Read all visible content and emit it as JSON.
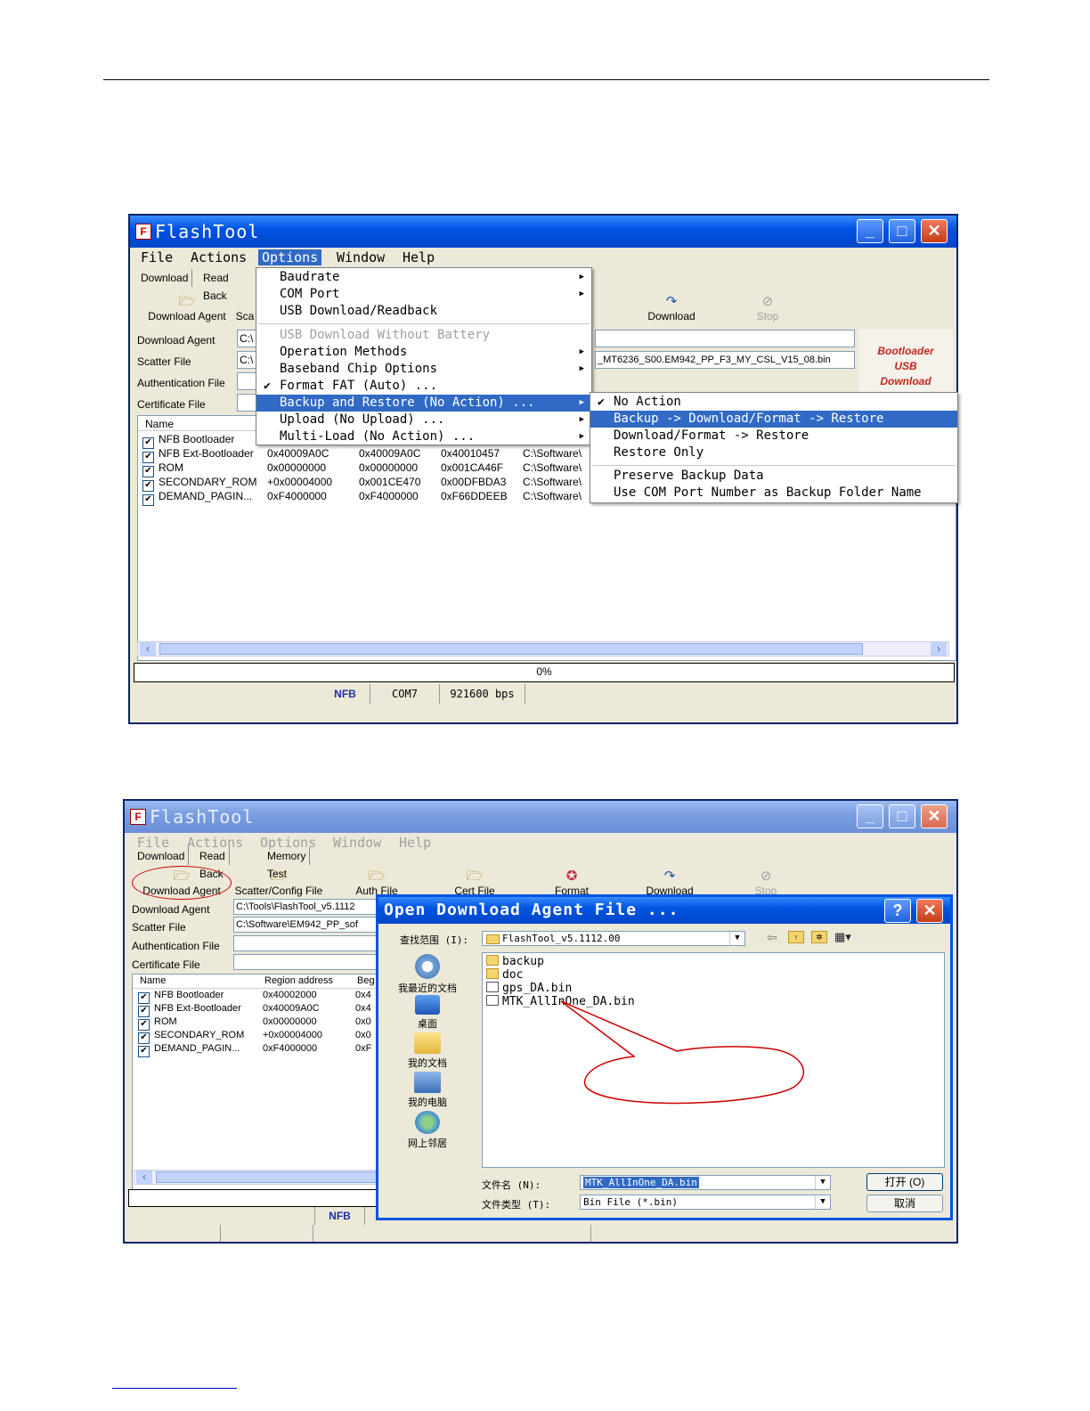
{
  "window1": {
    "title": "FlashTool",
    "menus": [
      "File",
      "Actions",
      "Options",
      "Window",
      "Help"
    ],
    "tabs": [
      "Download",
      "Read Back"
    ],
    "toolbar": {
      "download_agent": "Download Agent",
      "scatter": "Sca",
      "download": "Download",
      "stop": "Stop"
    },
    "fields": {
      "download_agent_label": "Download Agent",
      "download_agent_value": "C:\\",
      "scatter_label": "Scatter File",
      "scatter_value": "C:\\",
      "scatter_tail": "_MT6236_S00.EM942_PP_F3_MY_CSL_V15_08.bin",
      "auth_label": "Authentication File",
      "cert_label": "Certificate File"
    },
    "logo": {
      "line1": "Bootloader",
      "line2": "USB",
      "line3": "Download"
    },
    "list_header": "Name",
    "rows": [
      {
        "name": "NFB Bootloader",
        "c1": "",
        "c2": "",
        "c3": "",
        "c4": ""
      },
      {
        "name": "NFB Ext-Bootloader",
        "c1": "0x40009A0C",
        "c2": "0x40009A0C",
        "c3": "0x40010457",
        "c4": "C:\\Software\\"
      },
      {
        "name": "ROM",
        "c1": "0x00000000",
        "c2": "0x00000000",
        "c3": "0x001CA46F",
        "c4": "C:\\Software\\"
      },
      {
        "name": "SECONDARY_ROM",
        "c1": "+0x00004000",
        "c2": "0x001CE470",
        "c3": "0x00DFBDA3",
        "c4": "C:\\Software\\"
      },
      {
        "name": "DEMAND_PAGIN...",
        "c1": "0xF4000000",
        "c2": "0xF4000000",
        "c3": "0xF66DDEEB",
        "c4": "C:\\Software\\"
      }
    ],
    "progress": "0%",
    "status": {
      "type": "NFB",
      "port": "COM7",
      "baud": "921600 bps"
    },
    "options_menu": [
      {
        "label": "Baudrate",
        "sub": true
      },
      {
        "label": "COM Port",
        "sub": true
      },
      {
        "label": "USB Download/Readback"
      },
      {
        "label": "USB Download Without Battery",
        "disabled": true
      },
      {
        "label": "Operation Methods",
        "sub": true
      },
      {
        "label": "Baseband Chip Options",
        "sub": true
      },
      {
        "label": "Format FAT (Auto) ...",
        "checked": true
      },
      {
        "label": "Backup and Restore (No Action) ...",
        "sub": true,
        "highlight": true
      },
      {
        "label": "Upload (No Upload) ...",
        "sub": true
      },
      {
        "label": "Multi-Load (No Action) ...",
        "sub": true
      }
    ],
    "backup_submenu": [
      {
        "label": "No Action",
        "checked": true
      },
      {
        "label": "Backup -> Download/Format -> Restore",
        "highlight": true
      },
      {
        "label": "Download/Format -> Restore"
      },
      {
        "label": "Restore Only"
      },
      {
        "label": "Preserve Backup Data"
      },
      {
        "label": "Use COM Port Number as Backup Folder Name"
      }
    ]
  },
  "window2": {
    "title": "FlashTool",
    "menus": [
      "File",
      "Actions",
      "Options",
      "Window",
      "Help"
    ],
    "tabs": [
      "Download",
      "Read Back",
      "Memory Test"
    ],
    "toolbar": [
      "Download Agent",
      "Scatter/Config File",
      "Auth File",
      "Cert File",
      "Format",
      "Download",
      "Stop"
    ],
    "fields": {
      "download_agent_label": "Download Agent",
      "download_agent_value": "C:\\Tools\\FlashTool_v5.1112",
      "scatter_label": "Scatter File",
      "scatter_value": "C:\\Software\\EM942_PP_sof",
      "auth_label": "Authentication File",
      "cert_label": "Certificate File"
    },
    "list_headers": [
      "Name",
      "Region address",
      "Beg"
    ],
    "rows": [
      {
        "name": "NFB Bootloader",
        "addr": "0x40002000",
        "beg": "0x4"
      },
      {
        "name": "NFB Ext-Bootloader",
        "addr": "0x40009A0C",
        "beg": "0x4"
      },
      {
        "name": "ROM",
        "addr": "0x00000000",
        "beg": "0x0"
      },
      {
        "name": "SECONDARY_ROM",
        "addr": "+0x00004000",
        "beg": "0x0"
      },
      {
        "name": "DEMAND_PAGIN...",
        "addr": "0xF4000000",
        "beg": "0xF"
      }
    ],
    "status_type": "NFB"
  },
  "dialog": {
    "title": "Open Download Agent File ...",
    "look_in_label": "查找范围 (I):",
    "look_in_value": "FlashTool_v5.1112.00",
    "places": [
      "我最近的文档",
      "桌面",
      "我的文档",
      "我的电脑",
      "网上邻居"
    ],
    "files": [
      {
        "name": "backup",
        "type": "folder"
      },
      {
        "name": "doc",
        "type": "folder"
      },
      {
        "name": "gps_DA.bin",
        "type": "bin"
      },
      {
        "name": "MTK_AllInOne_DA.bin",
        "type": "bin"
      }
    ],
    "filename_label": "文件名 (N):",
    "filename_value": "MTK_AllInOne_DA.bin",
    "filetype_label": "文件类型 (T):",
    "filetype_value": "Bin File (*.bin)",
    "open_button": "打开 (O)",
    "cancel_button": "取消"
  },
  "colors": {
    "xp_blue": "#0054e3",
    "highlight": "#316ac5",
    "annotation": "#cc0000",
    "xp_face": "#ece9d8"
  }
}
